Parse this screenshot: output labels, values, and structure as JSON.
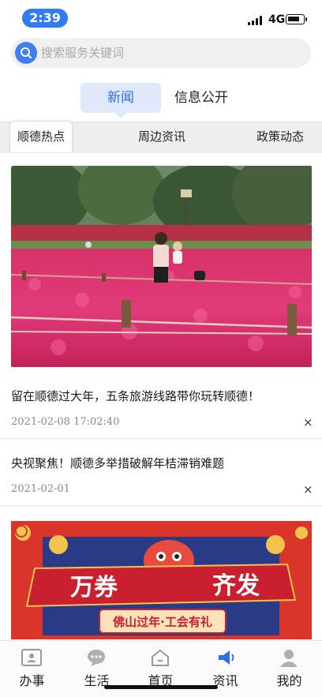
{
  "status_bar": {
    "time": "2:39",
    "network": "4G"
  },
  "search": {
    "placeholder": "搜索服务关键词"
  },
  "top_tabs": [
    {
      "label": "新闻",
      "active": true
    },
    {
      "label": "信息公开",
      "active": false
    }
  ],
  "sub_tabs": [
    {
      "label": "顺德热点",
      "active": true
    },
    {
      "label": "周边资讯",
      "active": false
    },
    {
      "label": "政策动态",
      "active": false
    }
  ],
  "news": [
    {
      "title": "留在顺德过大年，五条旅游线路带你玩转顺德！",
      "date": "2021-02-08 17:02:40",
      "close": "×"
    },
    {
      "title": "央视聚焦！顺德多举措破解年桔滞销难题",
      "date": "2021-02-01",
      "close": "×"
    }
  ],
  "banner": {
    "main_left": "万券",
    "main_right": "齐发",
    "subtitle": "佛山过年·工会有礼"
  },
  "bottom_nav": [
    {
      "label": "办事",
      "icon": "id-card-icon"
    },
    {
      "label": "生活",
      "icon": "chat-bubble-icon"
    },
    {
      "label": "首页",
      "icon": "home-icon"
    },
    {
      "label": "资讯",
      "icon": "megaphone-icon",
      "active": true
    },
    {
      "label": "我的",
      "icon": "person-icon"
    }
  ],
  "colors": {
    "accent": "#2f6fe4",
    "time_pill": "#2f7cf6",
    "active_tab_bg": "#dfe9fb",
    "banner_red": "#d9352b"
  }
}
